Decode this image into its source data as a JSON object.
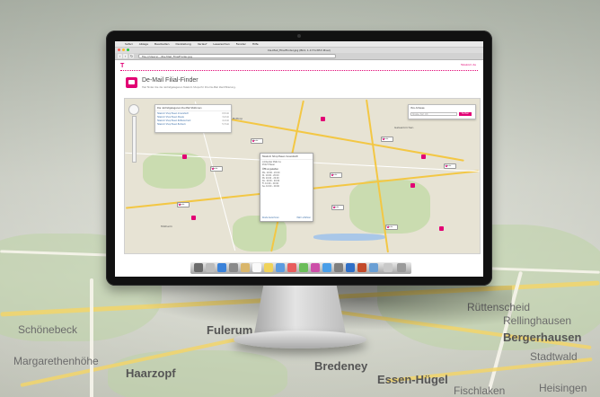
{
  "menubar": {
    "apple": "",
    "items": [
      "Safari",
      "Ablage",
      "Bearbeiten",
      "Darstellung",
      "Verlauf",
      "Lesezeichen",
      "Fenster",
      "Hilfe"
    ]
  },
  "browser": {
    "title": "De-Mail_FilialFinder.jpg (Bild, 1.173×853 Pixel)",
    "url": "file:///Users/.../De-Mail_FilialFinder.jpg"
  },
  "page": {
    "logo": "T",
    "contact_link": "Telekom.de",
    "app_title": "De-Mail Filial-Finder",
    "app_description": "Hier finden Sie die nächstgelegenen Telekom Shops für Ihre De-Mail Identifizierung."
  },
  "nearest": {
    "title": "Die nächstgelegenen De-Mail Stationen",
    "rows": [
      {
        "name": "Telekom Shop Essen Innenstadt",
        "distance": "0,5 km"
      },
      {
        "name": "Telekom Shop Essen Steele",
        "distance": "3,2 km"
      },
      {
        "name": "Telekom Shop Essen Rüttenscheid",
        "distance": "4,1 km"
      },
      {
        "name": "Telekom Shop Essen Borbeck",
        "distance": "5,7 km"
      }
    ]
  },
  "search": {
    "title": "Ihre Adresse",
    "placeholder": "Straße, PLZ, Ort",
    "button": "Suchen"
  },
  "popup": {
    "title": "Telekom Shop Essen Innenstadt",
    "address": [
      "Limbecker Platz 1a",
      "45127 Essen"
    ],
    "hours_title": "Öffnungszeiten",
    "hours": [
      "Mo. 10:00 - 20:00",
      "Di. 10:00 - 20:00",
      "Mi. 10:00 - 20:00",
      "Do. 10:00 - 20:00",
      "Fr. 10:00 - 20:00",
      "Sa. 10:00 - 20:00"
    ],
    "link_route": "Route berechnen",
    "link_more": "Mehr erfahren"
  },
  "map": {
    "labels": [
      "Essen",
      "Mülheim",
      "Gelsenkirchen",
      "Bottrop"
    ],
    "markers": [
      "T-Punkt",
      "T-Punkt",
      "T-Punkt",
      "T-Punkt",
      "T-Punkt",
      "T-Punkt",
      "T-Punkt",
      "T-Punkt"
    ]
  },
  "background_labels": [
    "Fulerum",
    "Haarzopf",
    "Bredeney",
    "Essen-Hügel",
    "Bergerhausen",
    "Rellinghausen",
    "Stadtwald",
    "Schönebeck",
    "Fischlaken",
    "Heisingen",
    "Rüttenscheid",
    "Margarethenhöhe"
  ],
  "colors": {
    "brand": "#e20074",
    "link": "#3b6ea8"
  }
}
